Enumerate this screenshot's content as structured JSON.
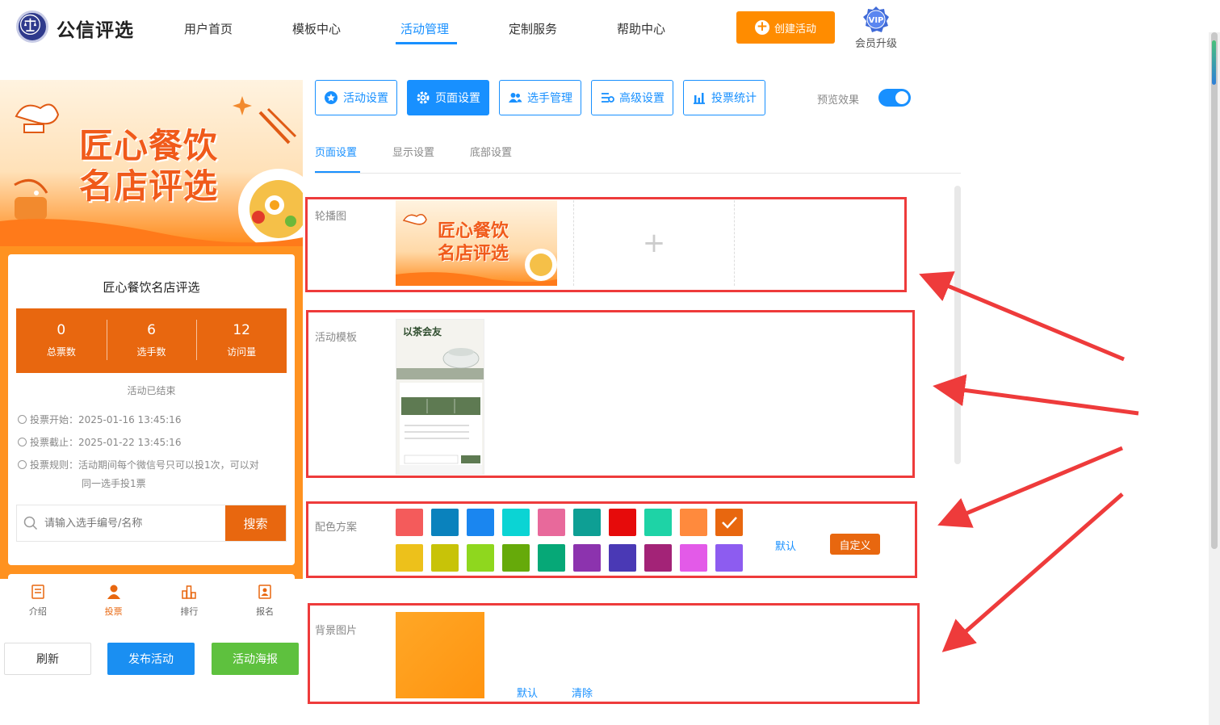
{
  "brand": {
    "name": "公信评选"
  },
  "nav": {
    "items": [
      {
        "label": "用户首页"
      },
      {
        "label": "模板中心"
      },
      {
        "label": "活动管理"
      },
      {
        "label": "定制服务"
      },
      {
        "label": "帮助中心"
      }
    ],
    "create_button": "创建活动",
    "vip_badge": "VIP",
    "vip_label": "会员升级"
  },
  "preview": {
    "banner_line1": "匠心餐饮",
    "banner_line2": "名店评选",
    "title": "匠心餐饮名店评选",
    "stats": [
      {
        "value": "0",
        "label": "总票数"
      },
      {
        "value": "6",
        "label": "选手数"
      },
      {
        "value": "12",
        "label": "访问量"
      }
    ],
    "status": "活动已结束",
    "rules": [
      {
        "text": "投票开始：2025-01-16 13:45:16"
      },
      {
        "text": "投票截止：2025-01-22 13:45:16"
      },
      {
        "text": "投票规则：活动期间每个微信号只可以投1次，可以对"
      },
      {
        "text": "同一选手投1票"
      }
    ],
    "search_placeholder": "请输入选手编号/名称",
    "search_button": "搜索",
    "tabs": [
      {
        "label": "介绍"
      },
      {
        "label": "投票"
      },
      {
        "label": "排行"
      },
      {
        "label": "报名"
      }
    ]
  },
  "bottom_buttons": {
    "refresh": "刷新",
    "publish": "发布活动",
    "poster": "活动海报"
  },
  "toolbar": {
    "buttons": [
      {
        "label": "活动设置"
      },
      {
        "label": "页面设置"
      },
      {
        "label": "选手管理"
      },
      {
        "label": "高级设置"
      },
      {
        "label": "投票统计"
      }
    ],
    "preview_label": "预览效果"
  },
  "subtabs": [
    {
      "label": "页面设置"
    },
    {
      "label": "显示设置"
    },
    {
      "label": "底部设置"
    }
  ],
  "sections": {
    "carousel": {
      "label": "轮播图",
      "thumb_line1": "匠心餐饮",
      "thumb_line2": "名店评选",
      "add_symbol": "+"
    },
    "template": {
      "label": "活动模板",
      "thumb_title": "以茶会友"
    },
    "colors": {
      "label": "配色方案",
      "row1": [
        "#f45b5b",
        "#0a82bd",
        "#1a86f0",
        "#0bd4d4",
        "#e8699b",
        "#0e9f94",
        "#e60b0b",
        "#1ed3a6",
        "#ff8a3d",
        "#e8670f"
      ],
      "row2": [
        "#edc11b",
        "#c8c308",
        "#8fd71e",
        "#66aa0a",
        "#06a877",
        "#8c33ae",
        "#4a39b5",
        "#a32377",
        "#e35ae8",
        "#8d5cf0"
      ],
      "selected_color": "#e8670f",
      "default_link": "默认",
      "custom_button": "自定义"
    },
    "background": {
      "label": "背景图片",
      "default_link": "默认",
      "clear_link": "清除"
    }
  },
  "colors": {
    "primary": "#1890ff",
    "accent": "#e8670f",
    "annotation": "#ee3b3b"
  }
}
